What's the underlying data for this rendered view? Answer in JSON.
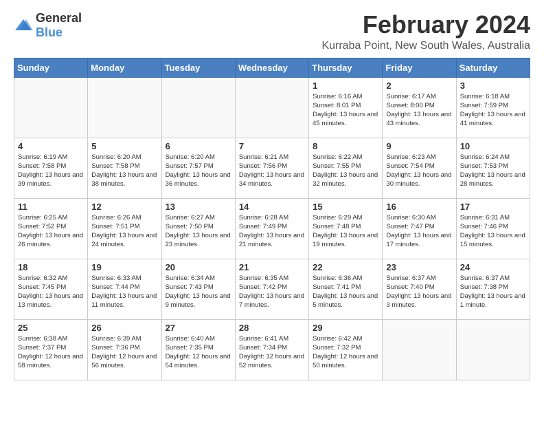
{
  "header": {
    "logo_general": "General",
    "logo_blue": "Blue",
    "month_title": "February 2024",
    "location": "Kurraba Point, New South Wales, Australia"
  },
  "weekdays": [
    "Sunday",
    "Monday",
    "Tuesday",
    "Wednesday",
    "Thursday",
    "Friday",
    "Saturday"
  ],
  "weeks": [
    [
      {
        "day": "",
        "sunrise": "",
        "sunset": "",
        "daylight": ""
      },
      {
        "day": "",
        "sunrise": "",
        "sunset": "",
        "daylight": ""
      },
      {
        "day": "",
        "sunrise": "",
        "sunset": "",
        "daylight": ""
      },
      {
        "day": "",
        "sunrise": "",
        "sunset": "",
        "daylight": ""
      },
      {
        "day": "1",
        "sunrise": "Sunrise: 6:16 AM",
        "sunset": "Sunset: 8:01 PM",
        "daylight": "Daylight: 13 hours and 45 minutes."
      },
      {
        "day": "2",
        "sunrise": "Sunrise: 6:17 AM",
        "sunset": "Sunset: 8:00 PM",
        "daylight": "Daylight: 13 hours and 43 minutes."
      },
      {
        "day": "3",
        "sunrise": "Sunrise: 6:18 AM",
        "sunset": "Sunset: 7:59 PM",
        "daylight": "Daylight: 13 hours and 41 minutes."
      }
    ],
    [
      {
        "day": "4",
        "sunrise": "Sunrise: 6:19 AM",
        "sunset": "Sunset: 7:58 PM",
        "daylight": "Daylight: 13 hours and 39 minutes."
      },
      {
        "day": "5",
        "sunrise": "Sunrise: 6:20 AM",
        "sunset": "Sunset: 7:58 PM",
        "daylight": "Daylight: 13 hours and 38 minutes."
      },
      {
        "day": "6",
        "sunrise": "Sunrise: 6:20 AM",
        "sunset": "Sunset: 7:57 PM",
        "daylight": "Daylight: 13 hours and 36 minutes."
      },
      {
        "day": "7",
        "sunrise": "Sunrise: 6:21 AM",
        "sunset": "Sunset: 7:56 PM",
        "daylight": "Daylight: 13 hours and 34 minutes."
      },
      {
        "day": "8",
        "sunrise": "Sunrise: 6:22 AM",
        "sunset": "Sunset: 7:55 PM",
        "daylight": "Daylight: 13 hours and 32 minutes."
      },
      {
        "day": "9",
        "sunrise": "Sunrise: 6:23 AM",
        "sunset": "Sunset: 7:54 PM",
        "daylight": "Daylight: 13 hours and 30 minutes."
      },
      {
        "day": "10",
        "sunrise": "Sunrise: 6:24 AM",
        "sunset": "Sunset: 7:53 PM",
        "daylight": "Daylight: 13 hours and 28 minutes."
      }
    ],
    [
      {
        "day": "11",
        "sunrise": "Sunrise: 6:25 AM",
        "sunset": "Sunset: 7:52 PM",
        "daylight": "Daylight: 13 hours and 26 minutes."
      },
      {
        "day": "12",
        "sunrise": "Sunrise: 6:26 AM",
        "sunset": "Sunset: 7:51 PM",
        "daylight": "Daylight: 13 hours and 24 minutes."
      },
      {
        "day": "13",
        "sunrise": "Sunrise: 6:27 AM",
        "sunset": "Sunset: 7:50 PM",
        "daylight": "Daylight: 13 hours and 23 minutes."
      },
      {
        "day": "14",
        "sunrise": "Sunrise: 6:28 AM",
        "sunset": "Sunset: 7:49 PM",
        "daylight": "Daylight: 13 hours and 21 minutes."
      },
      {
        "day": "15",
        "sunrise": "Sunrise: 6:29 AM",
        "sunset": "Sunset: 7:48 PM",
        "daylight": "Daylight: 13 hours and 19 minutes."
      },
      {
        "day": "16",
        "sunrise": "Sunrise: 6:30 AM",
        "sunset": "Sunset: 7:47 PM",
        "daylight": "Daylight: 13 hours and 17 minutes."
      },
      {
        "day": "17",
        "sunrise": "Sunrise: 6:31 AM",
        "sunset": "Sunset: 7:46 PM",
        "daylight": "Daylight: 13 hours and 15 minutes."
      }
    ],
    [
      {
        "day": "18",
        "sunrise": "Sunrise: 6:32 AM",
        "sunset": "Sunset: 7:45 PM",
        "daylight": "Daylight: 13 hours and 13 minutes."
      },
      {
        "day": "19",
        "sunrise": "Sunrise: 6:33 AM",
        "sunset": "Sunset: 7:44 PM",
        "daylight": "Daylight: 13 hours and 11 minutes."
      },
      {
        "day": "20",
        "sunrise": "Sunrise: 6:34 AM",
        "sunset": "Sunset: 7:43 PM",
        "daylight": "Daylight: 13 hours and 9 minutes."
      },
      {
        "day": "21",
        "sunrise": "Sunrise: 6:35 AM",
        "sunset": "Sunset: 7:42 PM",
        "daylight": "Daylight: 13 hours and 7 minutes."
      },
      {
        "day": "22",
        "sunrise": "Sunrise: 6:36 AM",
        "sunset": "Sunset: 7:41 PM",
        "daylight": "Daylight: 13 hours and 5 minutes."
      },
      {
        "day": "23",
        "sunrise": "Sunrise: 6:37 AM",
        "sunset": "Sunset: 7:40 PM",
        "daylight": "Daylight: 13 hours and 3 minutes."
      },
      {
        "day": "24",
        "sunrise": "Sunrise: 6:37 AM",
        "sunset": "Sunset: 7:38 PM",
        "daylight": "Daylight: 13 hours and 1 minute."
      }
    ],
    [
      {
        "day": "25",
        "sunrise": "Sunrise: 6:38 AM",
        "sunset": "Sunset: 7:37 PM",
        "daylight": "Daylight: 12 hours and 58 minutes."
      },
      {
        "day": "26",
        "sunrise": "Sunrise: 6:39 AM",
        "sunset": "Sunset: 7:36 PM",
        "daylight": "Daylight: 12 hours and 56 minutes."
      },
      {
        "day": "27",
        "sunrise": "Sunrise: 6:40 AM",
        "sunset": "Sunset: 7:35 PM",
        "daylight": "Daylight: 12 hours and 54 minutes."
      },
      {
        "day": "28",
        "sunrise": "Sunrise: 6:41 AM",
        "sunset": "Sunset: 7:34 PM",
        "daylight": "Daylight: 12 hours and 52 minutes."
      },
      {
        "day": "29",
        "sunrise": "Sunrise: 6:42 AM",
        "sunset": "Sunset: 7:32 PM",
        "daylight": "Daylight: 12 hours and 50 minutes."
      },
      {
        "day": "",
        "sunrise": "",
        "sunset": "",
        "daylight": ""
      },
      {
        "day": "",
        "sunrise": "",
        "sunset": "",
        "daylight": ""
      }
    ]
  ]
}
